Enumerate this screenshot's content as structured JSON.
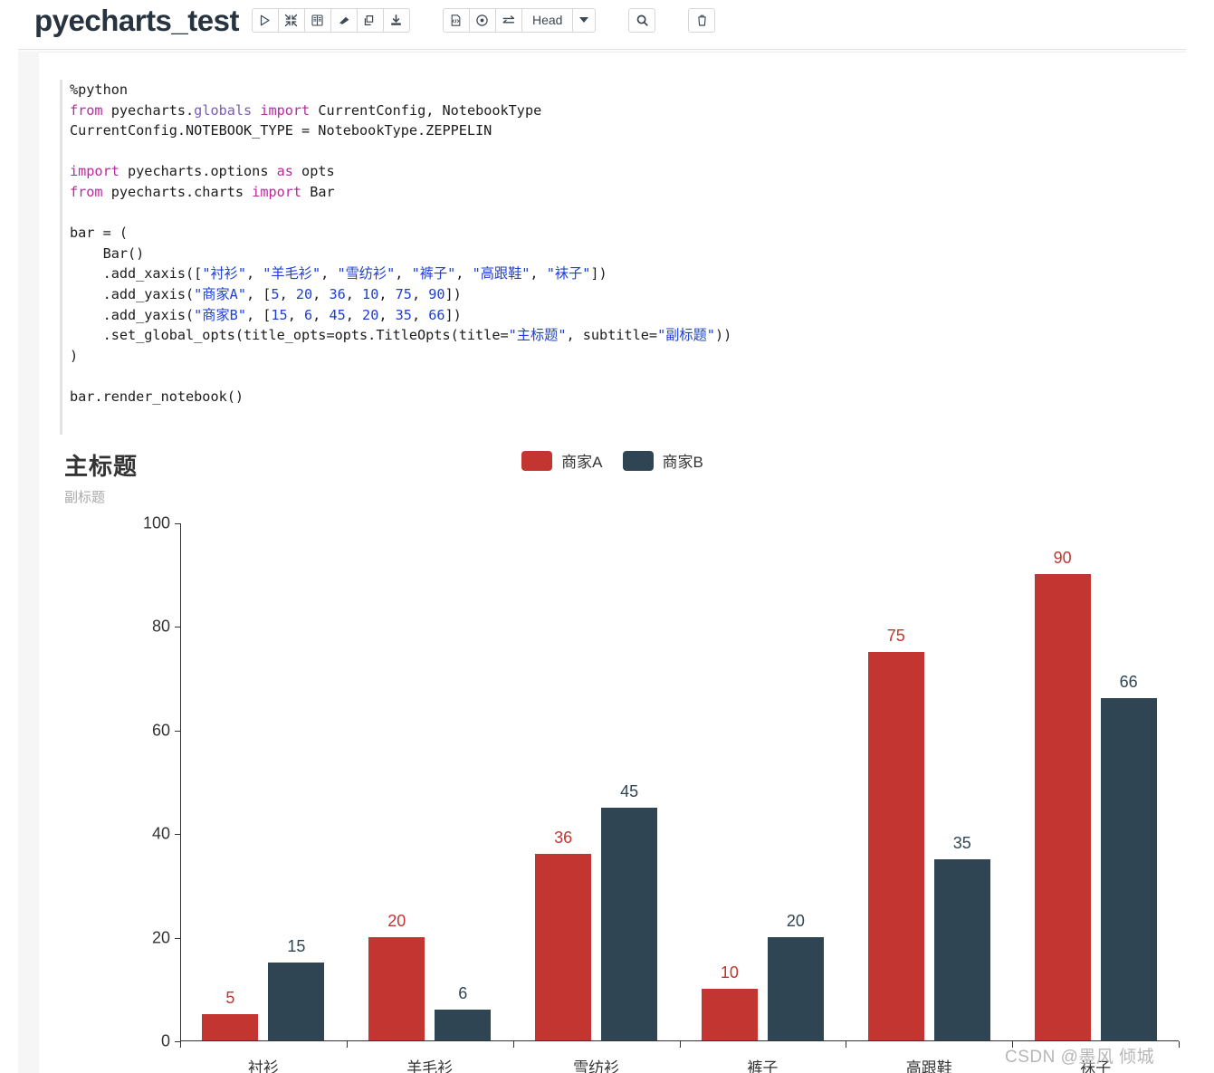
{
  "toolbar": {
    "notebook_title": "pyecharts_test",
    "group1": [
      {
        "name": "run-paragraph-button",
        "icon": "play-triangle-icon"
      },
      {
        "name": "hide-output-button",
        "icon": "collapse-arrows-icon"
      },
      {
        "name": "show-title-button",
        "icon": "book-icon"
      },
      {
        "name": "clear-output-button",
        "icon": "eraser-icon"
      },
      {
        "name": "clone-paragraph-button",
        "icon": "copy-icon"
      },
      {
        "name": "export-button",
        "icon": "download-icon"
      }
    ],
    "group2": [
      {
        "name": "code-view-button",
        "icon": "code-file-icon"
      },
      {
        "name": "permissions-button",
        "icon": "target-circle-icon"
      },
      {
        "name": "toggle-button",
        "icon": "swap-arrows-icon"
      }
    ],
    "version_label": "Head",
    "dropdown_caret": "chevron-down-icon",
    "search_button": {
      "name": "search-button",
      "icon": "search-icon"
    },
    "delete_button": {
      "name": "delete-notebook-button",
      "icon": "trash-icon"
    }
  },
  "code": {
    "lines": [
      [
        {
          "t": "%python",
          "c": "plain"
        }
      ],
      [
        {
          "t": "from",
          "c": "kw"
        },
        {
          "t": " pyecharts.",
          "c": "plain"
        },
        {
          "t": "globals",
          "c": "mod"
        },
        {
          "t": " ",
          "c": "plain"
        },
        {
          "t": "import",
          "c": "kw"
        },
        {
          "t": " CurrentConfig, NotebookType",
          "c": "plain"
        }
      ],
      [
        {
          "t": "CurrentConfig.NOTEBOOK_TYPE = NotebookType.ZEPPELIN",
          "c": "plain"
        }
      ],
      [],
      [
        {
          "t": "import",
          "c": "kw"
        },
        {
          "t": " pyecharts.options ",
          "c": "plain"
        },
        {
          "t": "as",
          "c": "kw"
        },
        {
          "t": " opts",
          "c": "plain"
        }
      ],
      [
        {
          "t": "from",
          "c": "kw"
        },
        {
          "t": " pyecharts.charts ",
          "c": "plain"
        },
        {
          "t": "import",
          "c": "kw"
        },
        {
          "t": " Bar",
          "c": "plain"
        }
      ],
      [],
      [
        {
          "t": "bar = (",
          "c": "plain"
        }
      ],
      [
        {
          "t": "    Bar()",
          "c": "plain"
        }
      ],
      [
        {
          "t": "    .add_xaxis([",
          "c": "plain"
        },
        {
          "t": "\"衬衫\"",
          "c": "str"
        },
        {
          "t": ", ",
          "c": "plain"
        },
        {
          "t": "\"羊毛衫\"",
          "c": "str"
        },
        {
          "t": ", ",
          "c": "plain"
        },
        {
          "t": "\"雪纺衫\"",
          "c": "str"
        },
        {
          "t": ", ",
          "c": "plain"
        },
        {
          "t": "\"裤子\"",
          "c": "str"
        },
        {
          "t": ", ",
          "c": "plain"
        },
        {
          "t": "\"高跟鞋\"",
          "c": "str"
        },
        {
          "t": ", ",
          "c": "plain"
        },
        {
          "t": "\"袜子\"",
          "c": "str"
        },
        {
          "t": "])",
          "c": "plain"
        }
      ],
      [
        {
          "t": "    .add_yaxis(",
          "c": "plain"
        },
        {
          "t": "\"商家A\"",
          "c": "str"
        },
        {
          "t": ", [",
          "c": "plain"
        },
        {
          "t": "5",
          "c": "num"
        },
        {
          "t": ", ",
          "c": "plain"
        },
        {
          "t": "20",
          "c": "num"
        },
        {
          "t": ", ",
          "c": "plain"
        },
        {
          "t": "36",
          "c": "num"
        },
        {
          "t": ", ",
          "c": "plain"
        },
        {
          "t": "10",
          "c": "num"
        },
        {
          "t": ", ",
          "c": "plain"
        },
        {
          "t": "75",
          "c": "num"
        },
        {
          "t": ", ",
          "c": "plain"
        },
        {
          "t": "90",
          "c": "num"
        },
        {
          "t": "])",
          "c": "plain"
        }
      ],
      [
        {
          "t": "    .add_yaxis(",
          "c": "plain"
        },
        {
          "t": "\"商家B\"",
          "c": "str"
        },
        {
          "t": ", [",
          "c": "plain"
        },
        {
          "t": "15",
          "c": "num"
        },
        {
          "t": ", ",
          "c": "plain"
        },
        {
          "t": "6",
          "c": "num"
        },
        {
          "t": ", ",
          "c": "plain"
        },
        {
          "t": "45",
          "c": "num"
        },
        {
          "t": ", ",
          "c": "plain"
        },
        {
          "t": "20",
          "c": "num"
        },
        {
          "t": ", ",
          "c": "plain"
        },
        {
          "t": "35",
          "c": "num"
        },
        {
          "t": ", ",
          "c": "plain"
        },
        {
          "t": "66",
          "c": "num"
        },
        {
          "t": "])",
          "c": "plain"
        }
      ],
      [
        {
          "t": "    .set_global_opts(title_opts=opts.TitleOpts(title=",
          "c": "plain"
        },
        {
          "t": "\"主标题\"",
          "c": "str"
        },
        {
          "t": ", subtitle=",
          "c": "plain"
        },
        {
          "t": "\"副标题\"",
          "c": "str"
        },
        {
          "t": "))",
          "c": "plain"
        }
      ],
      [
        {
          "t": ")",
          "c": "plain"
        }
      ],
      [],
      [
        {
          "t": "bar.render_notebook()",
          "c": "plain"
        }
      ]
    ]
  },
  "chart_data": {
    "type": "bar",
    "title": "主标题",
    "subtitle": "副标题",
    "xlabel": "",
    "ylabel": "",
    "ylim": [
      0,
      100
    ],
    "yticks": [
      0,
      20,
      40,
      60,
      80,
      100
    ],
    "grid": false,
    "legend_position": "top-center",
    "categories": [
      "衬衫",
      "羊毛衫",
      "雪纺衫",
      "裤子",
      "高跟鞋",
      "袜子"
    ],
    "series": [
      {
        "name": "商家A",
        "color": "#c23531",
        "values": [
          5,
          20,
          36,
          10,
          75,
          90
        ]
      },
      {
        "name": "商家B",
        "color": "#2f4554",
        "values": [
          15,
          6,
          45,
          20,
          35,
          66
        ]
      }
    ]
  },
  "watermark": {
    "text": "CSDN @墨风 倾城"
  }
}
